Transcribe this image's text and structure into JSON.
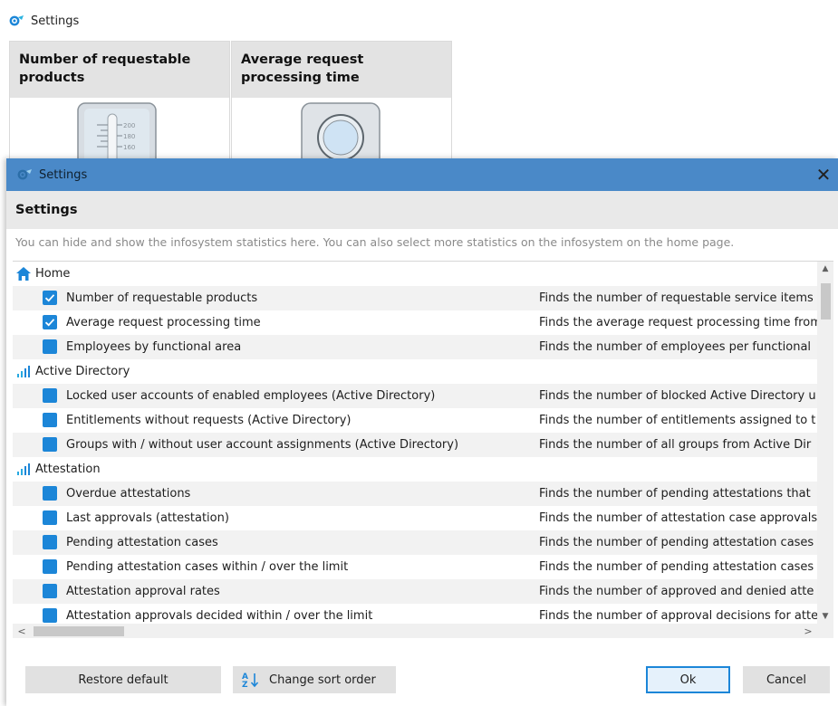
{
  "background": {
    "title": "Settings",
    "tiles": [
      {
        "title": "Number of requestable products"
      },
      {
        "title": "Average request processing time"
      }
    ],
    "gauge_scale": [
      "200",
      "180",
      "160"
    ]
  },
  "dialog": {
    "window_title": "Settings",
    "close_glyph": "✕",
    "section_title": "Settings",
    "hint": "You can hide and show the infosystem statistics here. You can also select more statistics on the infosystem on the home page.",
    "groups": [
      {
        "label": "Home",
        "icon": "home-icon",
        "items": [
          {
            "label": "Number of requestable products",
            "checked": true,
            "description": "Finds the number of requestable service items"
          },
          {
            "label": "Average request processing time",
            "checked": true,
            "description": "Finds the average request processing time from"
          },
          {
            "label": "Employees by functional area",
            "checked": false,
            "description": "Finds the number of employees per functional"
          }
        ]
      },
      {
        "label": "Active Directory",
        "icon": "bar-chart-icon",
        "items": [
          {
            "label": "Locked user accounts of enabled employees (Active Directory)",
            "checked": false,
            "description": "Finds the number of blocked Active Directory u"
          },
          {
            "label": "Entitlements without requests (Active Directory)",
            "checked": false,
            "description": "Finds the number of entitlements assigned to t"
          },
          {
            "label": "Groups with / without user account assignments (Active Directory)",
            "checked": false,
            "description": "Finds the number of all groups from Active Dir"
          }
        ]
      },
      {
        "label": "Attestation",
        "icon": "bar-chart-icon",
        "items": [
          {
            "label": "Overdue attestations",
            "checked": false,
            "description": "Finds the number of pending attestations that"
          },
          {
            "label": "Last approvals (attestation)",
            "checked": false,
            "description": "Finds the number of attestation case approvals"
          },
          {
            "label": "Pending attestation cases",
            "checked": false,
            "description": "Finds the number of pending attestation cases"
          },
          {
            "label": "Pending attestation cases within / over the limit",
            "checked": false,
            "description": "Finds the number of pending attestation cases"
          },
          {
            "label": "Attestation approval rates",
            "checked": false,
            "description": "Finds the number of approved and denied atte"
          },
          {
            "label": "Attestation approvals decided within / over the limit",
            "checked": false,
            "description": "Finds the number of approval decisions for atte"
          }
        ]
      }
    ],
    "buttons": {
      "restore": "Restore default",
      "sort": "Change sort order",
      "ok": "Ok",
      "cancel": "Cancel"
    },
    "scroll": {
      "up": "▲",
      "down": "▼",
      "left": "<",
      "right": ">"
    }
  },
  "colors": {
    "titlebar": "#4a89c8",
    "checkbox": "#1c86d8",
    "accent": "#1c86d8"
  }
}
